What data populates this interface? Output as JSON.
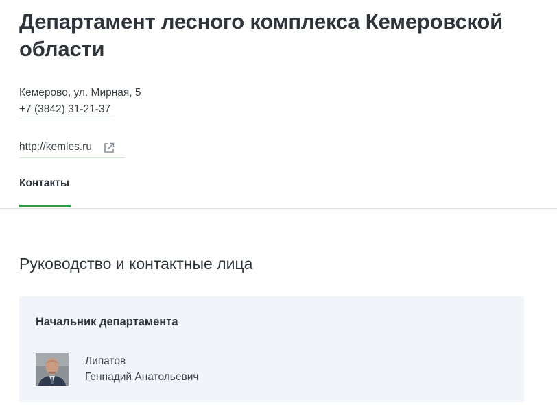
{
  "header": {
    "title": "Департамент лесного комплекса Кемеровской области",
    "address": "Кемерово, ул. Мирная, 5",
    "phone": "+7 (3842) 31-21-37",
    "website": "http://kemles.ru",
    "website_icon": "external-link-icon"
  },
  "tabs": [
    {
      "label": "Контакты",
      "active": true
    }
  ],
  "contacts": {
    "section_title": "Руководство и контактные лица",
    "cards": [
      {
        "role": "Начальник департамента",
        "surname": "Липатов",
        "given_names": "Геннадий Анатольевич",
        "photo_icon": "person-photo"
      }
    ]
  },
  "colors": {
    "accent": "#2e9a4d",
    "card_background": "#f1f4f8",
    "link_underline": "#cfe7d6",
    "divider": "#dfe2e5"
  }
}
